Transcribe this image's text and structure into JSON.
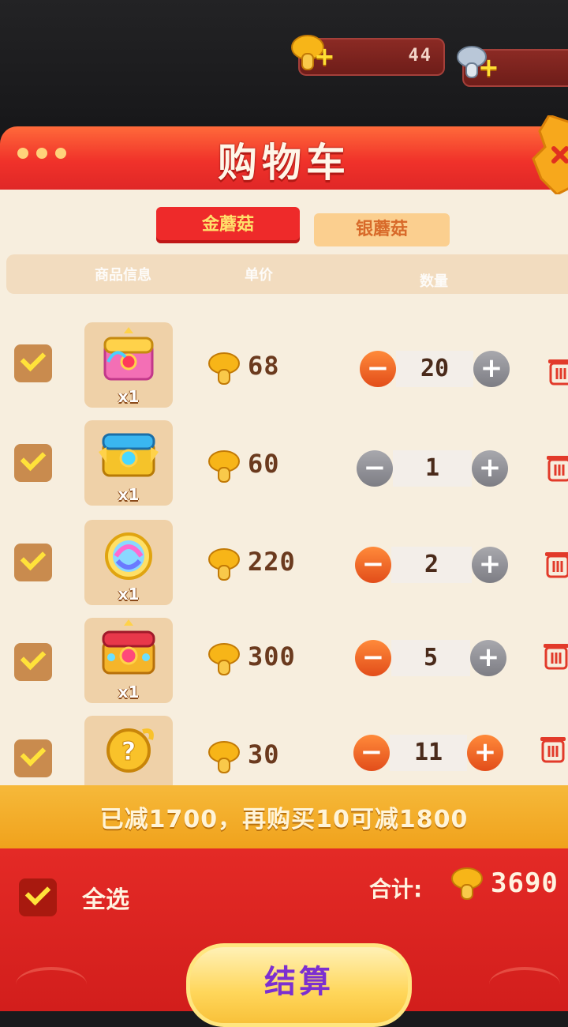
{
  "currency": {
    "gold": {
      "value": "44",
      "icon": "gold-mushroom-icon"
    },
    "silver": {
      "value": "",
      "icon": "silver-mushroom-icon"
    }
  },
  "panel": {
    "title": "购物车",
    "tabs": {
      "gold": "金蘑菇",
      "silver": "银蘑菇"
    },
    "columns": {
      "info": "商品信息",
      "price": "单价",
      "qty": "数量"
    }
  },
  "items": [
    {
      "thumb": "pink-treasure-chest-icon",
      "badge": "x1",
      "price": "68",
      "qty": "20",
      "minus_active": true,
      "plus_active": false
    },
    {
      "thumb": "gold-blue-chest-icon",
      "badge": "x1",
      "price": "60",
      "qty": "1",
      "minus_active": false,
      "plus_active": false
    },
    {
      "thumb": "rainbow-orb-icon",
      "badge": "x1",
      "price": "220",
      "qty": "2",
      "minus_active": true,
      "plus_active": false
    },
    {
      "thumb": "ruby-gold-chest-icon",
      "badge": "x1",
      "price": "300",
      "qty": "5",
      "minus_active": true,
      "plus_active": false
    },
    {
      "thumb": "mystery-coin-icon",
      "badge": "",
      "price": "30",
      "qty": "11",
      "minus_active": true,
      "plus_active": true
    }
  ],
  "discount": {
    "text": "已减1700，再购买10可减1800"
  },
  "footer": {
    "select_all": "全选",
    "total_label": "合计:",
    "total_value": "3690",
    "checkout": "结算"
  },
  "colors": {
    "accent": "#e42a26",
    "gold": "#f6b93a",
    "checkout_text": "#7c2fd0"
  }
}
